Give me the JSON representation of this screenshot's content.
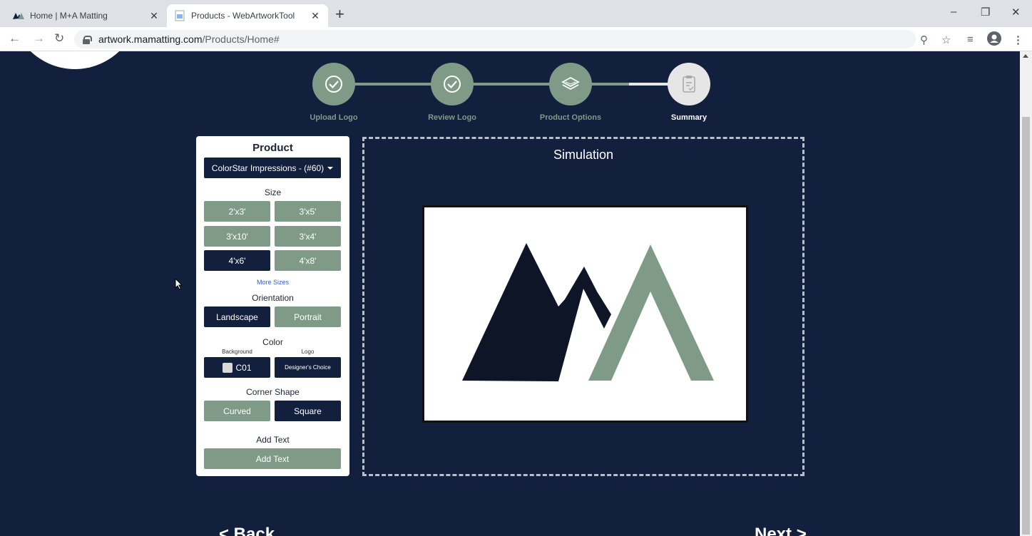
{
  "browser": {
    "tabs": [
      {
        "title": "Home | M+A Matting",
        "active": false
      },
      {
        "title": "Products - WebArtworkTool",
        "active": true
      }
    ],
    "url_host": "artwork.mamatting.com",
    "url_path": "/Products/Home#"
  },
  "stepper": {
    "steps": [
      {
        "label": "Upload Logo",
        "state": "done",
        "icon": "check-circle-icon"
      },
      {
        "label": "Review Logo",
        "state": "done",
        "icon": "check-circle-icon"
      },
      {
        "label": "Product Options",
        "state": "current",
        "icon": "layers-icon"
      },
      {
        "label": "Summary",
        "state": "pending",
        "icon": "clipboard-icon"
      }
    ]
  },
  "panel": {
    "product_heading": "Product",
    "product_selected": "ColorStar Impressions - (#60)",
    "size_heading": "Size",
    "sizes": [
      {
        "label": "2'x3'",
        "selected": false
      },
      {
        "label": "3'x5'",
        "selected": false
      },
      {
        "label": "3'x10'",
        "selected": false
      },
      {
        "label": "3'x4'",
        "selected": false
      },
      {
        "label": "4'x6'",
        "selected": true
      },
      {
        "label": "4'x8'",
        "selected": false
      }
    ],
    "more_sizes": "More Sizes",
    "orientation_heading": "Orientation",
    "orientation": {
      "landscape": "Landscape",
      "portrait": "Portrait",
      "selected": "Landscape"
    },
    "color_heading": "Color",
    "background_label": "Background",
    "logo_label": "Logo",
    "background_value": "C01",
    "logo_value": "Designer's Choice",
    "corner_heading": "Corner Shape",
    "corner": {
      "curved": "Curved",
      "square": "Square",
      "selected": "Square"
    },
    "add_text_heading": "Add Text",
    "add_text_button": "Add Text"
  },
  "simulation": {
    "title": "Simulation"
  },
  "footer": {
    "back": "< Back",
    "next": "Next >"
  },
  "colors": {
    "navy": "#121f3d",
    "sage": "#7f9b87",
    "pending": "#e6e6e6"
  }
}
